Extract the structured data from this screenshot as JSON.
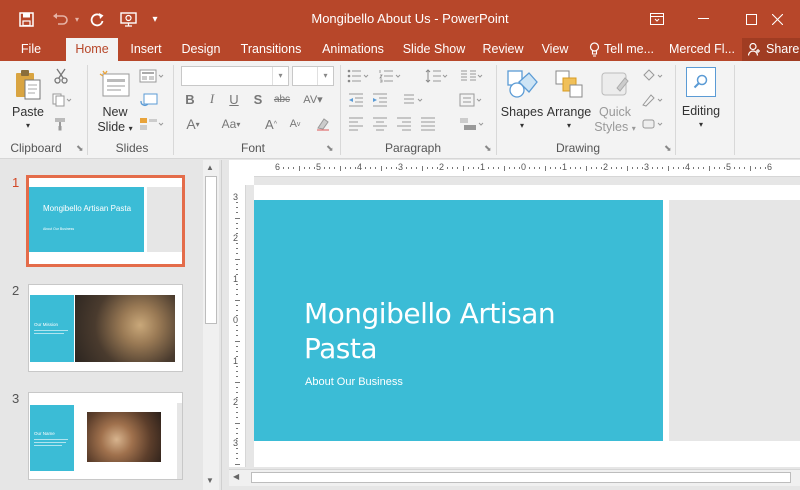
{
  "app": {
    "title": "Mongibello About Us - PowerPoint",
    "colors": {
      "brand": "#b7472a",
      "accent_teal": "#3bbcd6",
      "selected_border": "#e46c4a",
      "placeholder_gray": "#e6e6e6"
    }
  },
  "quick_access": [
    {
      "icon": "save-icon"
    },
    {
      "icon": "undo-icon"
    },
    {
      "icon": "redo-icon"
    },
    {
      "icon": "present-from-beginning-icon"
    },
    {
      "icon": "customize-quick-access-icon"
    }
  ],
  "window_controls": [
    {
      "icon": "ribbon-display-options-icon"
    },
    {
      "icon": "minimize-icon"
    },
    {
      "icon": "maximize-icon"
    },
    {
      "icon": "close-icon"
    }
  ],
  "tabs": [
    "File",
    "Home",
    "Insert",
    "Design",
    "Transitions",
    "Animations",
    "Slide Show",
    "Review",
    "View",
    "Tell me...",
    "Merced Fl...",
    "Share"
  ],
  "active_tab": "Home",
  "ribbon": {
    "groups": [
      "Clipboard",
      "Slides",
      "Font",
      "Paragraph",
      "Drawing",
      ""
    ],
    "clipboard": {
      "paste": "Paste"
    },
    "slides": {
      "new_slide_line1": "New",
      "new_slide_line2": "Slide"
    },
    "drawing": {
      "shapes": "Shapes",
      "arrange": "Arrange",
      "quick_styles_line1": "Quick",
      "quick_styles_line2": "Styles"
    },
    "editing": {
      "label": "Editing"
    }
  },
  "slides": [
    {
      "number": "1",
      "title": "Mongibello Artisan Pasta",
      "subtitle": "About Our Business",
      "selected": true
    },
    {
      "number": "2",
      "title": "Our Mission",
      "selected": false
    },
    {
      "number": "3",
      "title": "Our Name",
      "selected": false
    }
  ],
  "current_slide": {
    "title_line1": "Mongibello Artisan",
    "title_line2": "Pasta",
    "subtitle": "About Our Business"
  },
  "ruler": {
    "h_labels": [
      "6",
      "5",
      "4",
      "3",
      "2",
      "1",
      "0",
      "1",
      "2",
      "3",
      "4",
      "5",
      "6"
    ],
    "v_labels": [
      "3",
      "2",
      "1",
      "0",
      "1",
      "2",
      "3"
    ]
  }
}
